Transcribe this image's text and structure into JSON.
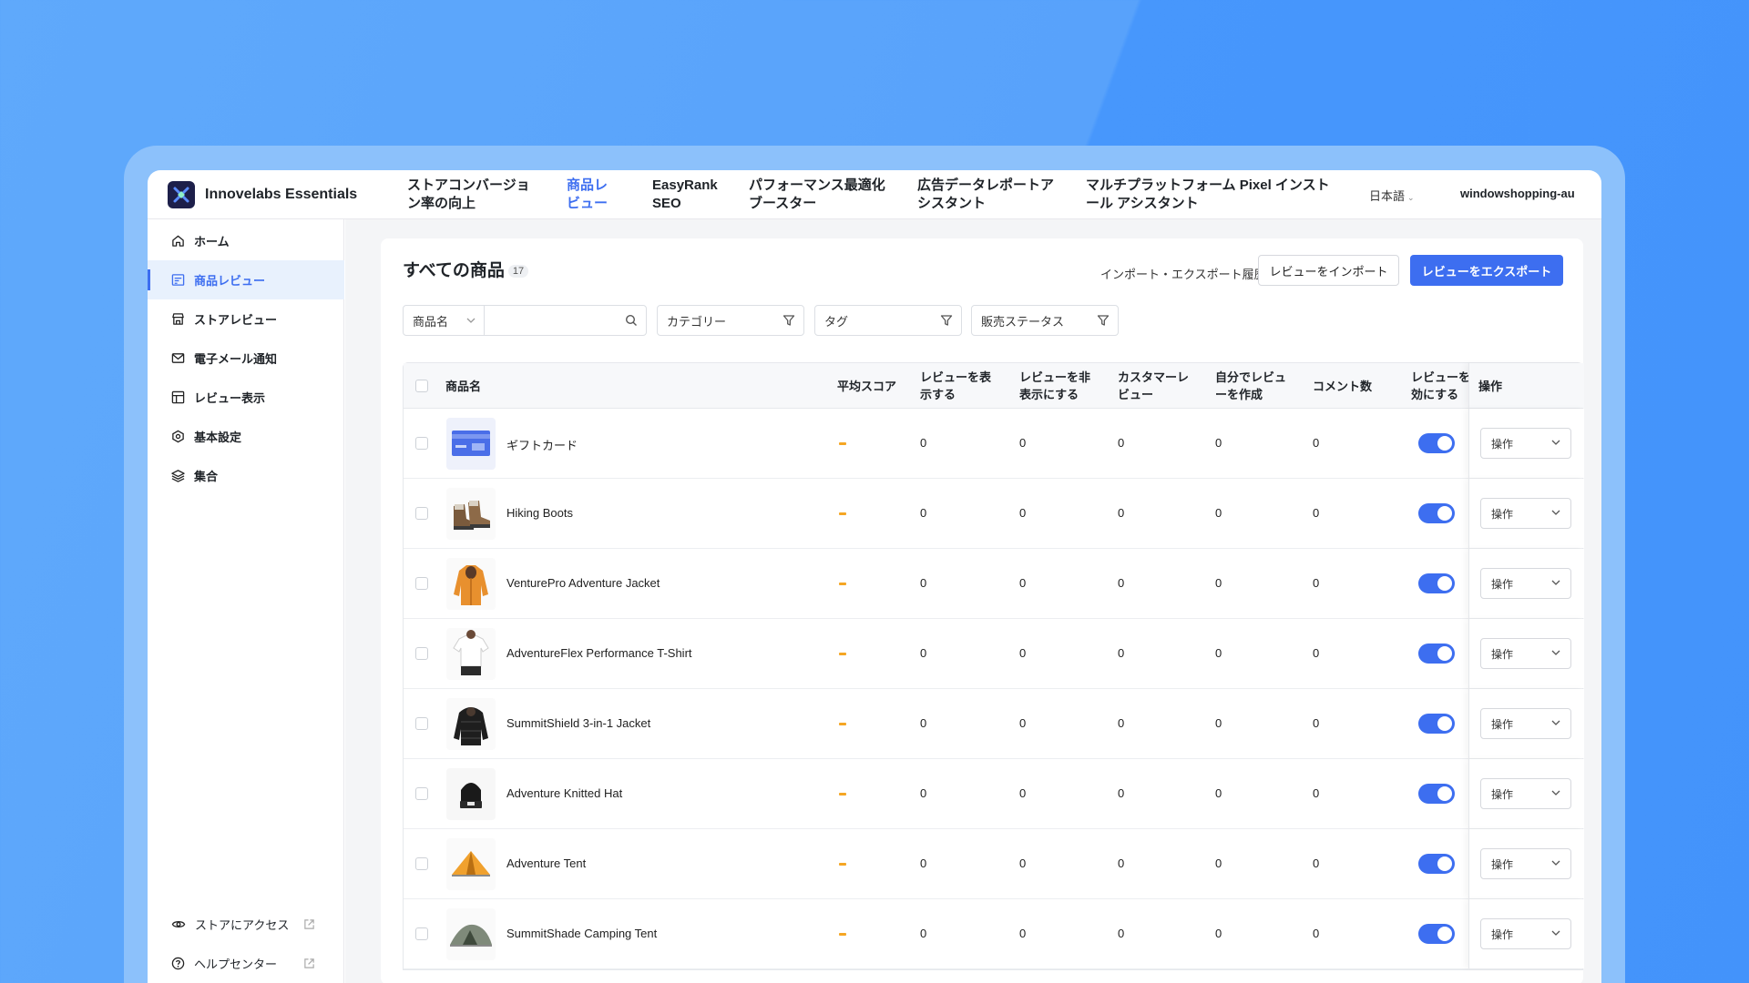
{
  "brand": {
    "name": "Innovelabs Essentials",
    "colors": {
      "accent": "#3d6ef0",
      "brand_bg": "#1d1f4a"
    }
  },
  "topnav": {
    "tabs": [
      {
        "line1": "ストアコンバージョ",
        "line2": "ン率の向上"
      },
      {
        "line1": "商品レ",
        "line2": "ビュー",
        "active": true
      },
      {
        "line1": "EasyRank",
        "line2": "SEO"
      },
      {
        "line1": "パフォーマンス最適化",
        "line2": "ブースター"
      },
      {
        "line1": "広告データレポートア",
        "line2": "シスタント"
      },
      {
        "line1": "マルチプラットフォーム Pixel インスト",
        "line2": "ール アシスタント"
      }
    ],
    "language": "日本語",
    "shop": "windowshopping-au"
  },
  "sidebar": {
    "items": [
      {
        "label": "ホーム",
        "icon": "home-icon"
      },
      {
        "label": "商品レビュー",
        "icon": "review-list-icon",
        "active": true
      },
      {
        "label": "ストアレビュー",
        "icon": "store-icon"
      },
      {
        "label": "電子メール通知",
        "icon": "mail-icon"
      },
      {
        "label": "レビュー表示",
        "icon": "layout-icon"
      },
      {
        "label": "基本設定",
        "icon": "settings-hex-icon"
      },
      {
        "label": "集合",
        "icon": "layers-icon"
      }
    ],
    "footer": [
      {
        "label": "ストアにアクセス",
        "icon": "eye-icon"
      },
      {
        "label": "ヘルプセンター",
        "icon": "help-icon"
      }
    ]
  },
  "main": {
    "title": "すべての商品",
    "count": "17",
    "history_link": "インポート・エクスポート履歴",
    "import_button": "レビューをインポート",
    "export_button": "レビューをエクスポート",
    "filters": {
      "field_select": "商品名",
      "category": "カテゴリー",
      "tag": "タグ",
      "sales_status": "販売ステータス"
    }
  },
  "table": {
    "headers": {
      "name": "商品名",
      "avg_score": "平均スコア",
      "show_reviews_1": "レビューを表",
      "show_reviews_2": "示する",
      "hide_reviews_1": "レビューを非",
      "hide_reviews_2": "表示にする",
      "customer_reviews_1": "カスタマーレ",
      "customer_reviews_2": "ビュー",
      "own_reviews_1": "自分でレビュ",
      "own_reviews_2": "ーを作成",
      "comments": "コメント数",
      "enable_1": "レビューを有",
      "enable_2": "効にする",
      "actions": "操作"
    },
    "rows": [
      {
        "name": "ギフトカード",
        "thumb": "gift-card",
        "show": "0",
        "hide": "0",
        "customer": "0",
        "own": "0",
        "comments": "0",
        "action": "操作"
      },
      {
        "name": "Hiking Boots",
        "thumb": "boots",
        "show": "0",
        "hide": "0",
        "customer": "0",
        "own": "0",
        "comments": "0",
        "action": "操作"
      },
      {
        "name": "VenturePro Adventure Jacket",
        "thumb": "orange-jacket",
        "show": "0",
        "hide": "0",
        "customer": "0",
        "own": "0",
        "comments": "0",
        "action": "操作"
      },
      {
        "name": "AdventureFlex Performance T-Shirt",
        "thumb": "tshirt",
        "show": "0",
        "hide": "0",
        "customer": "0",
        "own": "0",
        "comments": "0",
        "action": "操作"
      },
      {
        "name": "SummitShield 3-in-1 Jacket",
        "thumb": "black-jacket",
        "show": "0",
        "hide": "0",
        "customer": "0",
        "own": "0",
        "comments": "0",
        "action": "操作"
      },
      {
        "name": "Adventure Knitted Hat",
        "thumb": "hat",
        "show": "0",
        "hide": "0",
        "customer": "0",
        "own": "0",
        "comments": "0",
        "action": "操作"
      },
      {
        "name": "Adventure Tent",
        "thumb": "tent",
        "show": "0",
        "hide": "0",
        "customer": "0",
        "own": "0",
        "comments": "0",
        "action": "操作"
      },
      {
        "name": "SummitShade Camping Tent",
        "thumb": "camping-tent",
        "show": "0",
        "hide": "0",
        "customer": "0",
        "own": "0",
        "comments": "0",
        "action": "操作"
      }
    ]
  }
}
